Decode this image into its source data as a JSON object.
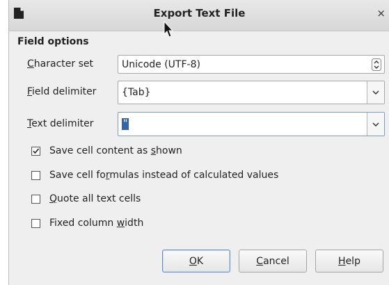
{
  "window": {
    "title": "Export Text File"
  },
  "field_options": {
    "heading": "Field options",
    "character_set": {
      "label_mnemonic": "C",
      "label_rest": "haracter set",
      "value": "Unicode (UTF-8)"
    },
    "field_delimiter": {
      "label_mnemonic": "F",
      "label_rest": "ield delimiter",
      "value": "{Tab}"
    },
    "text_delimiter": {
      "label_mnemonic": "T",
      "label_rest": "ext delimiter",
      "value": "\""
    }
  },
  "options": [
    {
      "checked": true,
      "label_pre": "Save cell content as ",
      "label_mnemonic": "s",
      "label_post": "hown"
    },
    {
      "checked": false,
      "label_pre": "Save cell fo",
      "label_mnemonic": "r",
      "label_post": "mulas instead of calculated values"
    },
    {
      "checked": false,
      "label_pre": "",
      "label_mnemonic": "Q",
      "label_post": "uote all text cells"
    },
    {
      "checked": false,
      "label_pre": "Fixed column ",
      "label_mnemonic": "w",
      "label_post": "idth"
    }
  ],
  "buttons": {
    "ok": {
      "mnemonic": "O",
      "rest": "K"
    },
    "cancel": {
      "mnemonic": "C",
      "rest": "ancel"
    },
    "help": {
      "mnemonic": "H",
      "rest": "elp"
    }
  },
  "icons": {
    "app": "document-icon",
    "close": "close-icon",
    "cursor": "mouse-cursor-icon",
    "spin": "spin-updown-icon",
    "dropdown": "chevron-down-icon",
    "check": "checkmark-icon"
  },
  "colors": {
    "dialog_background": "#efefef",
    "titlebar": "#dcdcdc",
    "default_button_border": "#6a8fbf",
    "selection": "#3465a4"
  }
}
